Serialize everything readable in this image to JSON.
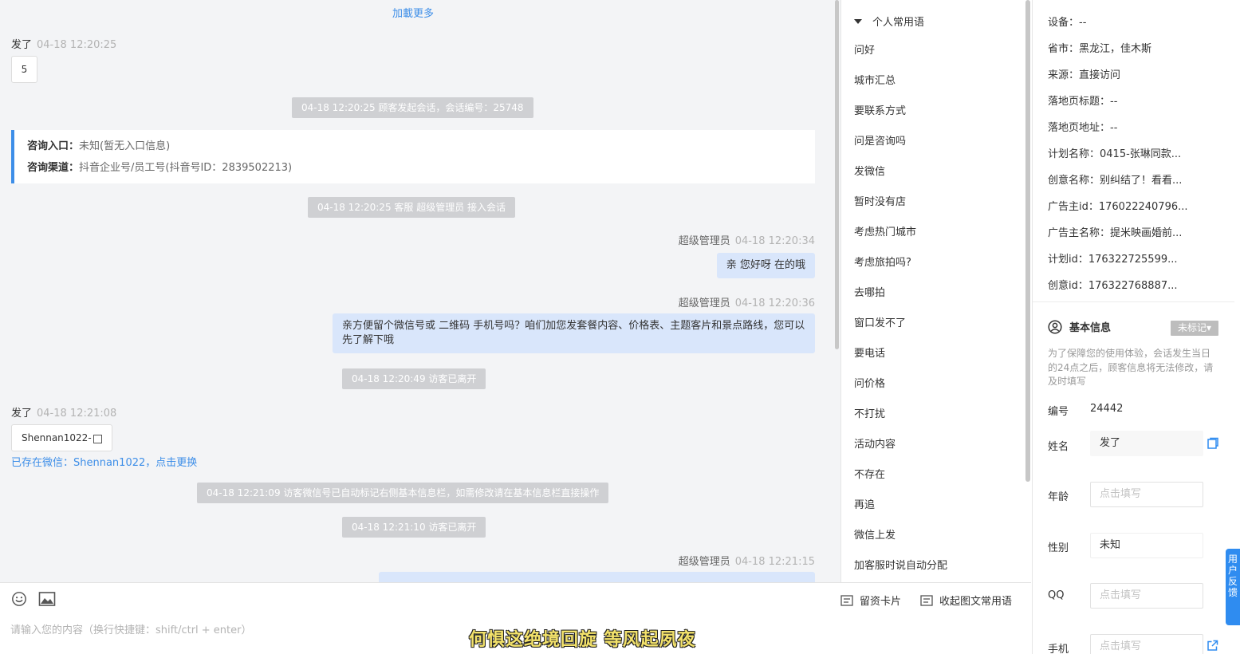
{
  "chat": {
    "load_more": "加載更多",
    "msg1": {
      "sender": "发了",
      "time": "04-18 12:20:25",
      "text": "5"
    },
    "sys1": "04-18 12:20:25 顾客发起会话，会话编号：25748",
    "info_card": {
      "entry_label": "咨询入口：",
      "entry_value": "未知(暂无入口信息)",
      "channel_label": "咨询渠道：",
      "channel_value": "抖音企业号/员工号(抖音号ID：2839502213)"
    },
    "sys2": "04-18 12:20:25 客服 超级管理员 接入会话",
    "msg2": {
      "sender": "超级管理员",
      "time": "04-18 12:20:34",
      "text": "亲 您好呀 在的哦"
    },
    "msg3": {
      "sender": "超级管理员",
      "time": "04-18 12:20:36",
      "text": "亲方便留个微信号或 二维码 手机号吗？咱们加您发套餐内容、价格表、主题客片和景点路线，您可以先了解下哦"
    },
    "sys3": "04-18 12:20:49 访客已离开",
    "msg4": {
      "sender": "发了",
      "time": "04-18 12:21:08",
      "text": "Shennan1022-"
    },
    "wx_link": "已存在微信：Shennan1022，点击更换",
    "sys4": "04-18 12:21:09 访客微信号已自动标记右侧基本信息栏，如需修改请在基本信息栏直接操作",
    "sys5": "04-18 12:21:10 访客已离开",
    "msg5": {
      "sender": "超级管理员",
      "time": "04-18 12:21:15"
    }
  },
  "input": {
    "placeholder": "请输入您的内容（换行快捷键：shift/ctrl + enter）",
    "card_btn": "留资卡片",
    "collect_btn": "收起图文常用语",
    "subtitle": "何惧这绝境回旋 等风起夙夜"
  },
  "quick": {
    "header": "个人常用语",
    "items": [
      "问好",
      "城市汇总",
      "要联系方式",
      "问是咨询吗",
      "发微信",
      "暂时没有店",
      "考虑热门城市",
      "考虑旅拍吗?",
      "去哪拍",
      "窗口发不了",
      "要电话",
      "问价格",
      "不打扰",
      "活动内容",
      "不存在",
      "再追",
      "微信上发",
      "加客服时说自动分配"
    ]
  },
  "info": {
    "meta": [
      "设备：--",
      "省市：黑龙江，佳木斯",
      "来源：直接访问",
      "落地页标题：--",
      "落地页地址：--",
      "计划名称：0415-张琳同款...",
      "创意名称：别纠结了！看看...",
      "广告主id：176022240796...",
      "广告主名称：提米映画婚前...",
      "计划id：176322725599...",
      "创意id：176322768887..."
    ],
    "basic_title": "基本信息",
    "tag_btn": "未标记▾",
    "notice": "为了保障您的使用体验，会话发生当日的24点之后，顾客信息将无法修改，请及时填写",
    "id_label": "编号",
    "id_value": "24442",
    "name_label": "姓名",
    "name_value": "发了",
    "age_label": "年龄",
    "age_placeholder": "点击填写",
    "gender_label": "性别",
    "gender_value": "未知",
    "qq_label": "QQ",
    "qq_placeholder": "点击填写",
    "phone_label": "手机",
    "phone_placeholder": "点击填写"
  },
  "feedback": [
    "用",
    "户",
    "反",
    "馈"
  ]
}
